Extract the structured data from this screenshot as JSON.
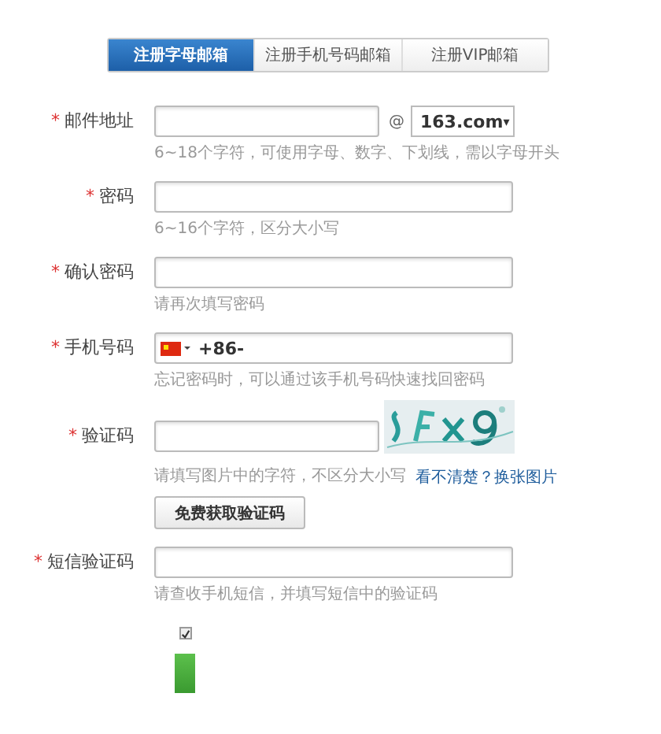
{
  "tabs": [
    {
      "label": "注册字母邮箱",
      "selected": true
    },
    {
      "label": "注册手机号码邮箱",
      "selected": false
    },
    {
      "label": "注册VIP邮箱",
      "selected": false
    }
  ],
  "fields": [
    {
      "kind": "email",
      "label": "邮件地址",
      "required_mark": "*",
      "at": "@",
      "domain": "163.com",
      "caret": "▾",
      "hint": "6~18个字符，可使用字母、数字、下划线，需以字母开头"
    },
    {
      "kind": "text",
      "label": "密码",
      "required_mark": "*",
      "hint": "6~16个字符，区分大小写"
    },
    {
      "kind": "text",
      "label": "确认密码",
      "required_mark": "*",
      "hint": "请再次填写密码"
    },
    {
      "kind": "phone",
      "label": "手机号码",
      "required_mark": "*",
      "value": "+86-",
      "hint": "忘记密码时，可以通过该手机号码快速找回密码"
    },
    {
      "kind": "captcha",
      "label": "验证码",
      "required_mark": "*",
      "hint": "请填写图片中的字符，不区分大小写",
      "link": "看不清楚？换张图片",
      "button": "免费获取验证码"
    },
    {
      "kind": "text",
      "label": "短信验证码",
      "required_mark": "*",
      "hint": "请查收手机短信，并填写短信中的验证码"
    }
  ],
  "agreement": {
    "checked": true
  }
}
